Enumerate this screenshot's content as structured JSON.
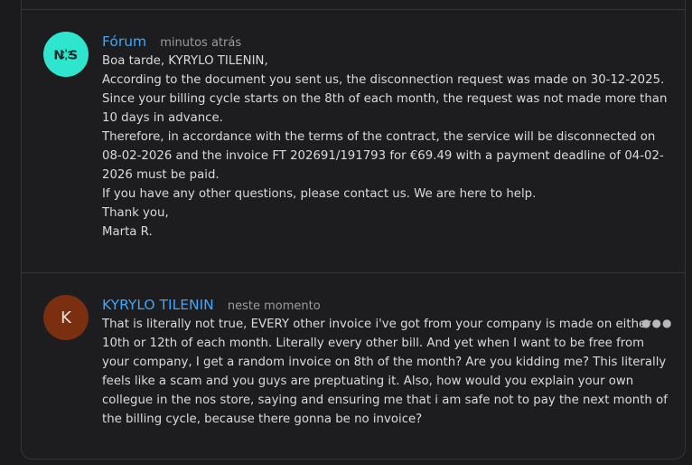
{
  "posts": [
    {
      "author": "Fórum",
      "time": "minutos atrás",
      "avatar": {
        "text": "NOS",
        "color": "#2ee6cd"
      },
      "lines": [
        "Boa tarde, KYRYLO TILENIN,",
        "According to the document you sent us, the disconnection request was made on 30-12-2025.",
        "Since your billing cycle starts on the 8th of each month, the request was not made more than",
        "10 days in advance.",
        "Therefore, in accordance with the terms of the contract, the service will be disconnected on",
        "08-02-2026 and the invoice FT 202691/191793 for €69.49 with a payment deadline of 04-02-",
        "2026 must be paid.",
        "If you have any other questions, please contact us. We are here to help.",
        "Thank you,",
        "Marta R."
      ]
    },
    {
      "author": "KYRYLO TILENIN",
      "time": "neste momento",
      "avatar": {
        "text": "K",
        "color": "#7a2f10"
      },
      "lines": [
        "That is literally not true, EVERY other invoice i've got from your company is made on either",
        "10th or 12th of each month. Literally every other bill. And yet when I want to be free from",
        "your company, I get a random invoice on 8th of the month? Are you kidding me? This literally",
        "feels like a scam and you guys are preptuating it. Also, how would you explain your own",
        "collegue in the nos store, saying and ensuring me that i am safe not to pay the next month of",
        "the billing cycle, because there gonna be no invoice?"
      ]
    }
  ],
  "menu_icon": "more-horizontal-icon",
  "colors": {
    "accent": "#3ea6ff",
    "background": "#1b1b1d"
  }
}
